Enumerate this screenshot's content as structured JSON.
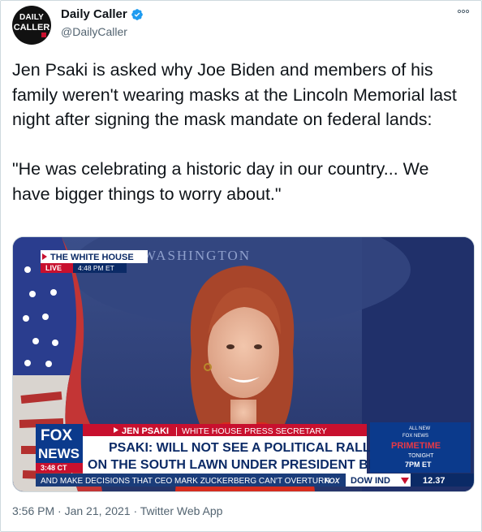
{
  "account": {
    "name": "Daily Caller",
    "handle": "@DailyCaller",
    "avatar_line1": "DAILY",
    "avatar_line2": "CALLER"
  },
  "tweet": {
    "text": "Jen Psaki is asked why Joe Biden and members of his family weren't wearing masks at the Lincoln Memorial last night after signing the mask mandate on federal lands:\n\n\"He was celebrating a historic day in our country... We have bigger things to worry about.\""
  },
  "media": {
    "location_tag": "THE WHITE HOUSE",
    "live_label": "LIVE",
    "live_time": "4:48 PM ET",
    "backdrop_text": "WASHINGTON",
    "network_top": "FOX",
    "network_bottom": "NEWS",
    "network_time": "3:48 CT",
    "lower_third_name": "JEN PSAKI",
    "lower_third_title": "WHITE HOUSE PRESS SECRETARY",
    "headline_line1": "PSAKI: WILL NOT SEE A POLITICAL RALLY",
    "headline_line2": "ON THE SOUTH LAWN UNDER PRESIDENT BIDEN",
    "ticker_text": "AND MAKE DECISIONS THAT CEO MARK ZUCKERBERG CAN'T OVERTURN",
    "ticker_brand": "FOX",
    "market_label": "DOW IND",
    "market_value": "12.37",
    "promo_line1": "ALL NEW",
    "promo_line2": "FOX NEWS",
    "promo_line3": "PRIMETIME",
    "promo_line4": "TONIGHT",
    "promo_line5": "7PM ET"
  },
  "meta": {
    "time": "3:56 PM",
    "sep1": " · ",
    "date": "Jan 21, 2021",
    "sep2": " · ",
    "source": "Twitter Web App"
  },
  "colors": {
    "verified": "#1d9bf0",
    "fox_red": "#c8102e",
    "fox_blue": "#0b3a8c"
  },
  "icons": [
    "verified-badge-icon",
    "more-options-icon"
  ]
}
